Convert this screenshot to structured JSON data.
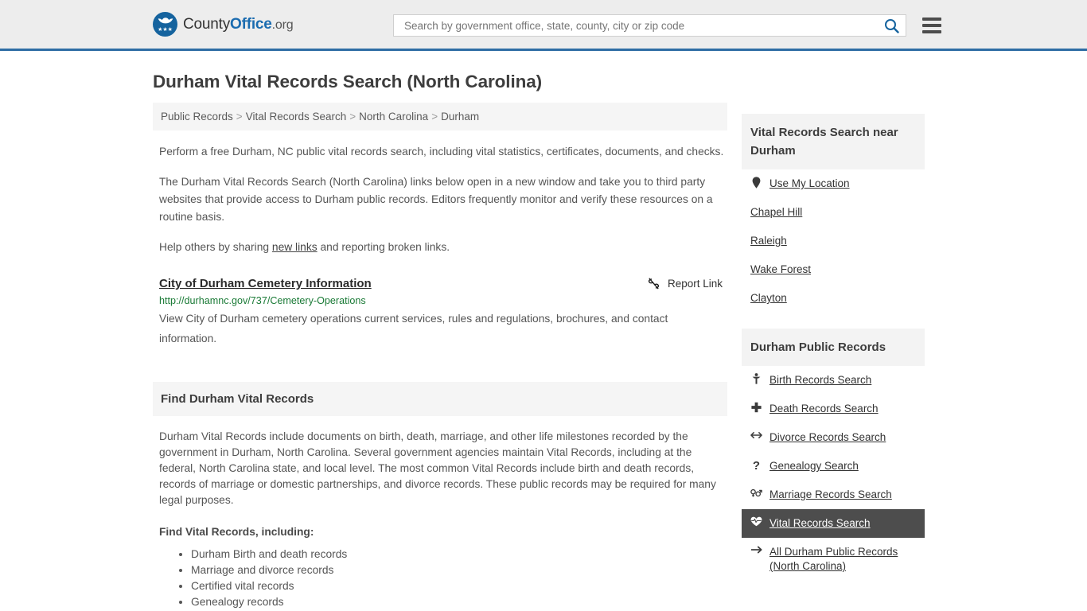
{
  "header": {
    "logo": {
      "prefix": "County",
      "accent": "Office",
      "suffix": ".org",
      "icon": "eagle-shield-icon",
      "stars": "★★★"
    },
    "search": {
      "placeholder": "Search by government office, state, county, city or zip code",
      "value": "",
      "icon": "search-icon"
    },
    "menu": {
      "icon": "hamburger-menu-icon"
    },
    "accent_color": "#2e6da4",
    "background": "#ededed"
  },
  "main": {
    "page_title": "Durham Vital Records Search (North Carolina)",
    "breadcrumb": [
      {
        "label": "Public Records"
      },
      {
        "label": "Vital Records Search"
      },
      {
        "label": "North Carolina"
      },
      {
        "label": "Durham"
      }
    ],
    "breadcrumb_separator": ">",
    "intro_paragraphs": [
      "Perform a free Durham, NC public vital records search, including vital statistics, certificates, documents, and checks.",
      "The Durham Vital Records Search (North Carolina) links below open in a new window and take you to third party websites that provide access to Durham public records. Editors frequently monitor and verify these resources on a routine basis."
    ],
    "share_prefix": "Help others by sharing ",
    "share_link": "new links",
    "share_suffix": " and reporting broken links.",
    "listing": {
      "title": "City of Durham Cemetery Information",
      "report_label": "Report Link",
      "report_icon": "broken-link-icon",
      "url": "http://durhamnc.gov/737/Cemetery-Operations",
      "url_color": "#1a7a36",
      "description": "View City of Durham cemetery operations current services, rules and regulations, brochures, and contact information."
    },
    "section": {
      "heading": "Find Durham Vital Records",
      "paragraph": "Durham Vital Records include documents on birth, death, marriage, and other life milestones recorded by the government in Durham, North Carolina. Several government agencies maintain Vital Records, including at the federal, North Carolina state, and local level. The most common Vital Records include birth and death records, records of marriage or domestic partnerships, and divorce records. These public records may be required for many legal purposes.",
      "list_lead": "Find Vital Records, including:",
      "list_items": [
        "Durham Birth and death records",
        "Marriage and divorce records",
        "Certified vital records",
        "Genealogy records"
      ]
    }
  },
  "sidebar": {
    "nearby": {
      "heading": "Vital Records Search near Durham",
      "items": [
        {
          "label": "Use My Location",
          "icon": "map-pin-icon"
        },
        {
          "label": "Chapel Hill",
          "icon": ""
        },
        {
          "label": "Raleigh",
          "icon": ""
        },
        {
          "label": "Wake Forest",
          "icon": ""
        },
        {
          "label": "Clayton",
          "icon": ""
        }
      ]
    },
    "public_records": {
      "heading": "Durham Public Records",
      "active_background": "#4d4d4d",
      "items": [
        {
          "label": "Birth Records Search",
          "icon": "baby-icon",
          "glyph": "Ɔ",
          "active": false
        },
        {
          "label": "Death Records Search",
          "icon": "cross-icon",
          "glyph": "✚",
          "active": false
        },
        {
          "label": "Divorce Records Search",
          "icon": "arrows-left-right-icon",
          "glyph": "↔",
          "active": false
        },
        {
          "label": "Genealogy Search",
          "icon": "question-mark-icon",
          "glyph": "?",
          "active": false
        },
        {
          "label": "Marriage Records Search",
          "icon": "venus-mars-icon",
          "glyph": "⚥",
          "active": false
        },
        {
          "label": "Vital Records Search",
          "icon": "heartbeat-icon",
          "glyph": "♥",
          "active": true
        },
        {
          "label": "All Durham Public Records (North Carolina)",
          "icon": "arrow-right-icon",
          "glyph": "→",
          "active": false
        }
      ]
    }
  }
}
